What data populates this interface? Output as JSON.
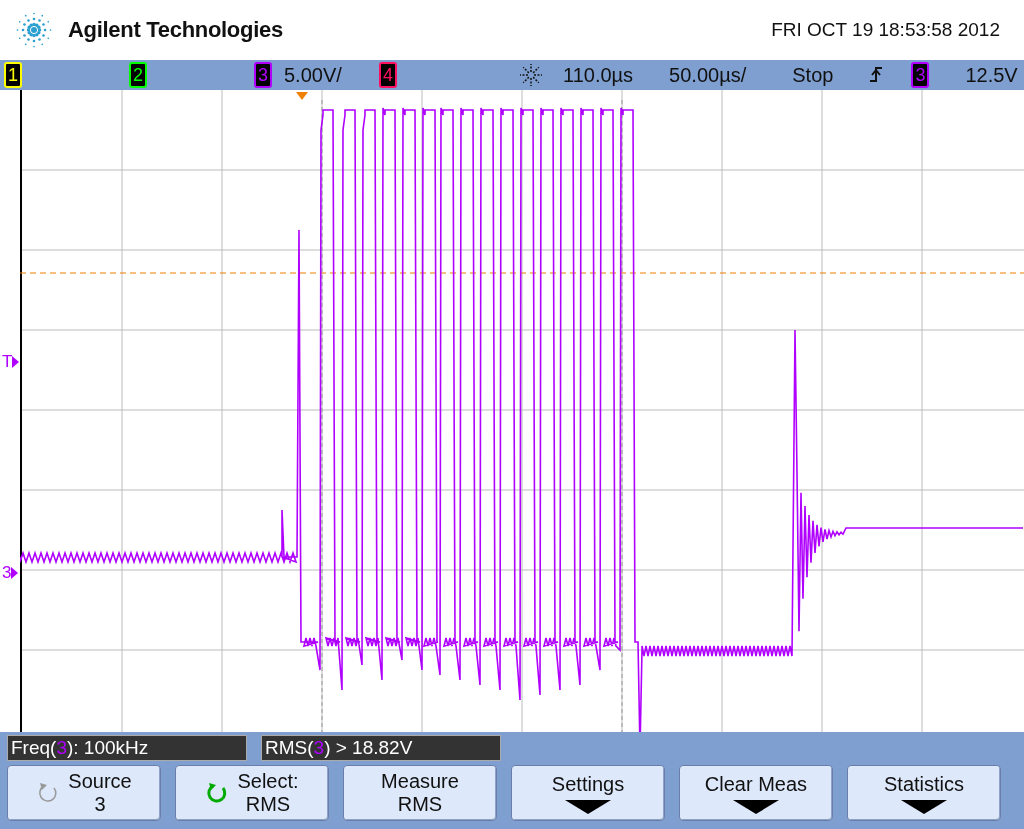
{
  "header": {
    "brand": "Agilent Technologies",
    "datetime": "FRI OCT 19 18:53:58 2012"
  },
  "status_bar": {
    "channels": [
      {
        "label": "1",
        "color": "#ffff00"
      },
      {
        "label": "2",
        "color": "#00ff00"
      },
      {
        "label": "3",
        "color": "#b000ff",
        "scale": "5.00V/"
      },
      {
        "label": "4",
        "color": "#ff1060"
      }
    ],
    "delay": "110.0µs",
    "timebase": "50.00µs/",
    "run_state": "Stop",
    "trigger_source": {
      "label": "3",
      "color": "#b000ff"
    },
    "trigger_level": "12.5V"
  },
  "markers": {
    "trigger": "T",
    "channel": "3",
    "color": "#b000ff"
  },
  "measurements": [
    {
      "prefix": "Freq(",
      "channel": "3",
      "suffix": "): 100kHz"
    },
    {
      "prefix": "RMS(",
      "channel": "3",
      "suffix": ") > 18.82V"
    }
  ],
  "softkeys": [
    {
      "kind": "cycle",
      "active": false,
      "label": "Source",
      "value": "3"
    },
    {
      "kind": "cycle",
      "active": true,
      "label": "Select:",
      "value": "RMS"
    },
    {
      "kind": "plain",
      "label": "Measure",
      "value": "RMS"
    },
    {
      "kind": "menu",
      "label": "Settings"
    },
    {
      "kind": "menu",
      "label": "Clear Meas"
    },
    {
      "kind": "menu",
      "label": "Statistics"
    }
  ]
}
